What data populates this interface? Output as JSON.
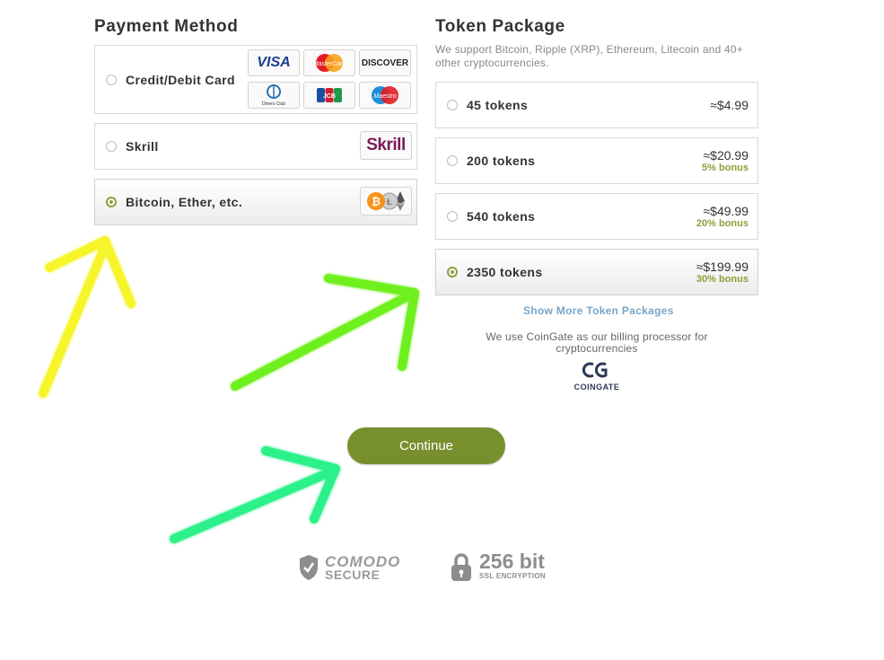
{
  "payment": {
    "title": "Payment Method",
    "options": [
      {
        "label": "Credit/Debit Card",
        "selected": false
      },
      {
        "label": "Skrill",
        "selected": false
      },
      {
        "label": "Bitcoin, Ether, etc.",
        "selected": true
      }
    ],
    "card_logos": {
      "visa": "VISA",
      "mastercard": "MasterCard",
      "discover": "DISCOVER",
      "diners": "Diners Club",
      "jcb": "JCB",
      "maestro": "Maestro"
    },
    "skrill_logo": "Skrill"
  },
  "tokens": {
    "title": "Token Package",
    "description": "We support Bitcoin, Ripple (XRP), Ethereum, Litecoin and 40+ other cryptocurrencies.",
    "packages": [
      {
        "label": "45 tokens",
        "price": "≈$4.99",
        "bonus": "",
        "selected": false
      },
      {
        "label": "200 tokens",
        "price": "≈$20.99",
        "bonus": "5% bonus",
        "selected": false
      },
      {
        "label": "540 tokens",
        "price": "≈$49.99",
        "bonus": "20% bonus",
        "selected": false
      },
      {
        "label": "2350 tokens",
        "price": "≈$199.99",
        "bonus": "30% bonus",
        "selected": true
      }
    ],
    "show_more": "Show More Token Packages",
    "processor_note": "We use CoinGate as our billing processor for cryptocurrencies",
    "coingate_logo": "COINGATE"
  },
  "continue_label": "Continue",
  "security": {
    "comodo_line1": "COMODO",
    "comodo_line2": "SECURE",
    "ssl_big": "256 bit",
    "ssl_small": "SSL ENCRYPTION"
  },
  "colors": {
    "accent": "#8aa03a",
    "button": "#788f2e",
    "link": "#79a6c8",
    "arrow_yellow": "#f5f52a",
    "arrow_green": "#6ff01e",
    "arrow_teal": "#2cf08a"
  }
}
